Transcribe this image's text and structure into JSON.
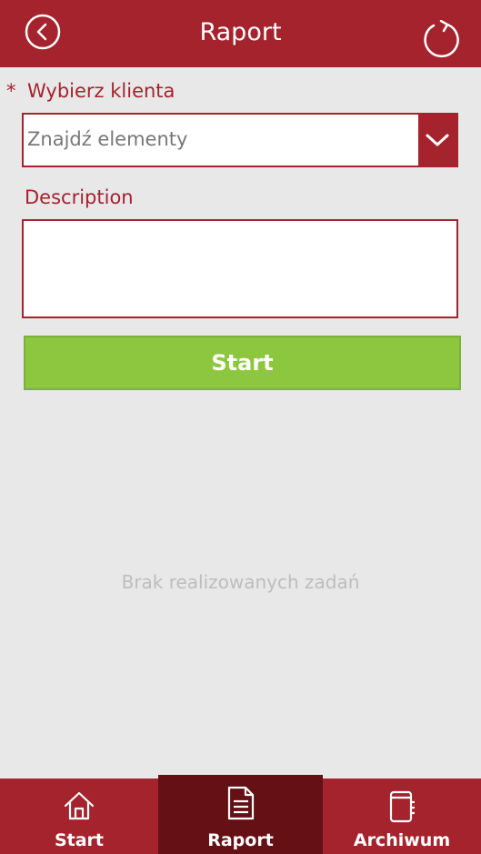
{
  "header": {
    "title": "Raport",
    "back_icon": "chevron-left-circle-icon",
    "refresh_icon": "refresh-icon"
  },
  "form": {
    "required_marker": "*",
    "client_label": "Wybierz klienta",
    "client_placeholder": "Znajdź elementy",
    "description_label": "Description",
    "description_value": "",
    "start_label": "Start"
  },
  "empty_message": "Brak realizowanych zadań",
  "tabs": [
    {
      "label": "Start",
      "icon": "home-icon",
      "active": false
    },
    {
      "label": "Raport",
      "icon": "document-icon",
      "active": true
    },
    {
      "label": "Archiwum",
      "icon": "notebook-icon",
      "active": false
    }
  ],
  "colors": {
    "brand": "#a4232d",
    "brand_dark": "#651014",
    "start_button": "#8dc63f",
    "background": "#e8e8e8"
  }
}
